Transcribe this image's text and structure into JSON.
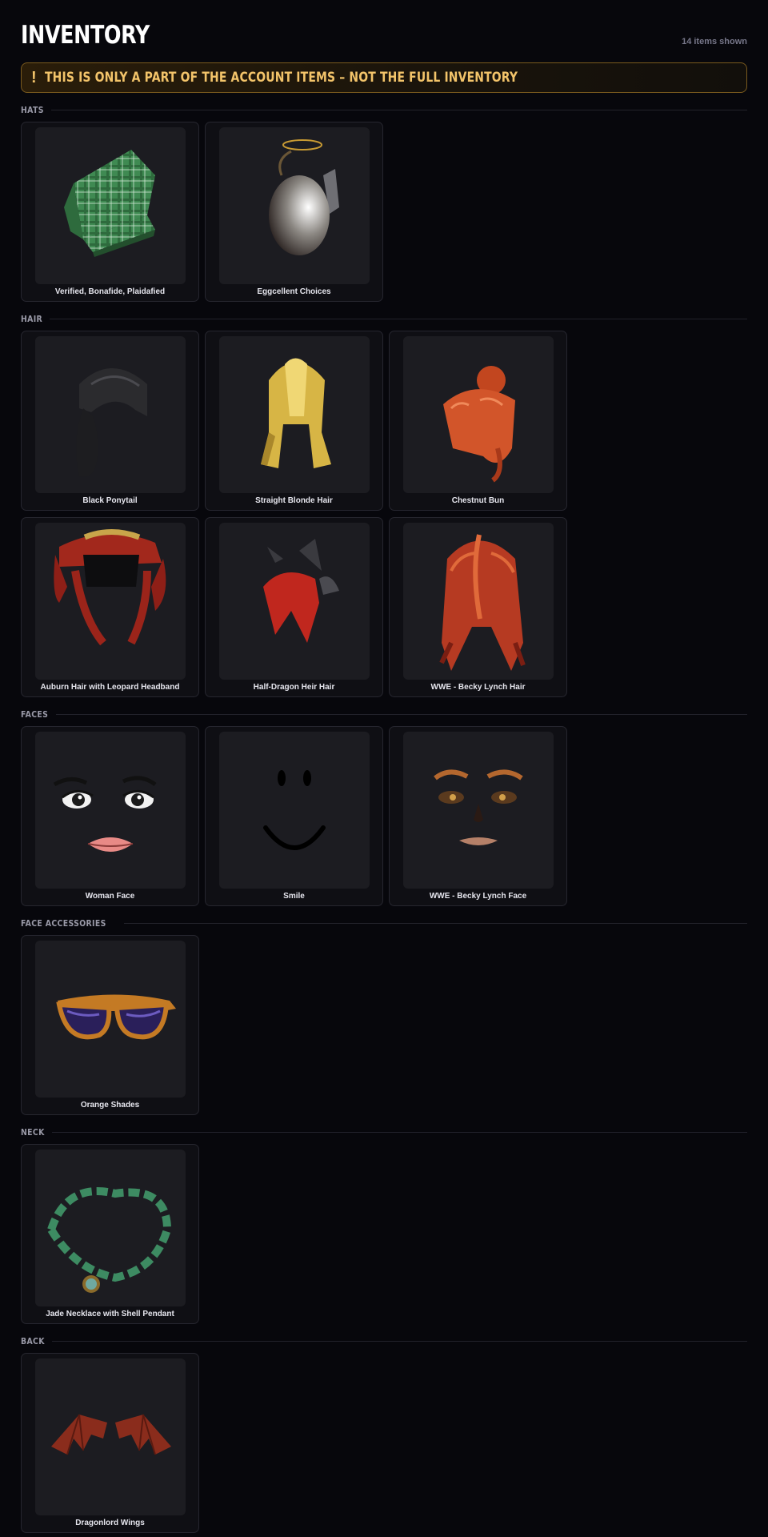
{
  "header": {
    "title": "INVENTORY",
    "count": "14 items shown"
  },
  "banner": {
    "icon": "!",
    "text": "THIS IS ONLY A PART OF THE ACCOUNT ITEMS – NOT THE FULL INVENTORY"
  },
  "sections": [
    {
      "label": "HATS",
      "items": [
        {
          "name": "Verified, Bonafide, Plaidafied",
          "icon": "plaid-cap"
        },
        {
          "name": "Eggcellent Choices",
          "icon": "egg"
        }
      ]
    },
    {
      "label": "HAIR",
      "items": [
        {
          "name": "Black Ponytail",
          "icon": "black-ponytail"
        },
        {
          "name": "Straight Blonde Hair",
          "icon": "blonde-hair"
        },
        {
          "name": "Chestnut Bun",
          "icon": "chestnut-bun"
        },
        {
          "name": "Auburn Hair with Leopard Headband",
          "icon": "auburn-hair"
        },
        {
          "name": "Half-Dragon Heir Hair",
          "icon": "dragon-hair"
        },
        {
          "name": "WWE - Becky Lynch Hair",
          "icon": "becky-hair"
        }
      ]
    },
    {
      "label": "FACES",
      "items": [
        {
          "name": "Woman Face",
          "icon": "woman-face"
        },
        {
          "name": "Smile",
          "icon": "smile-face"
        },
        {
          "name": "WWE - Becky Lynch Face",
          "icon": "becky-face"
        }
      ]
    },
    {
      "label": "FACE ACCESSORIES",
      "items": [
        {
          "name": "Orange Shades",
          "icon": "orange-shades"
        }
      ]
    },
    {
      "label": "NECK",
      "items": [
        {
          "name": "Jade Necklace with Shell Pendant",
          "icon": "jade-necklace"
        }
      ]
    },
    {
      "label": "BACK",
      "items": [
        {
          "name": "Dragonlord Wings",
          "icon": "dragon-wings"
        }
      ]
    }
  ],
  "colors": {
    "background": "#07070c",
    "card": "#0f0f14",
    "thumb": "#1c1c21",
    "banner_accent": "#f3c46a",
    "banner_border": "#7a5a1e"
  }
}
